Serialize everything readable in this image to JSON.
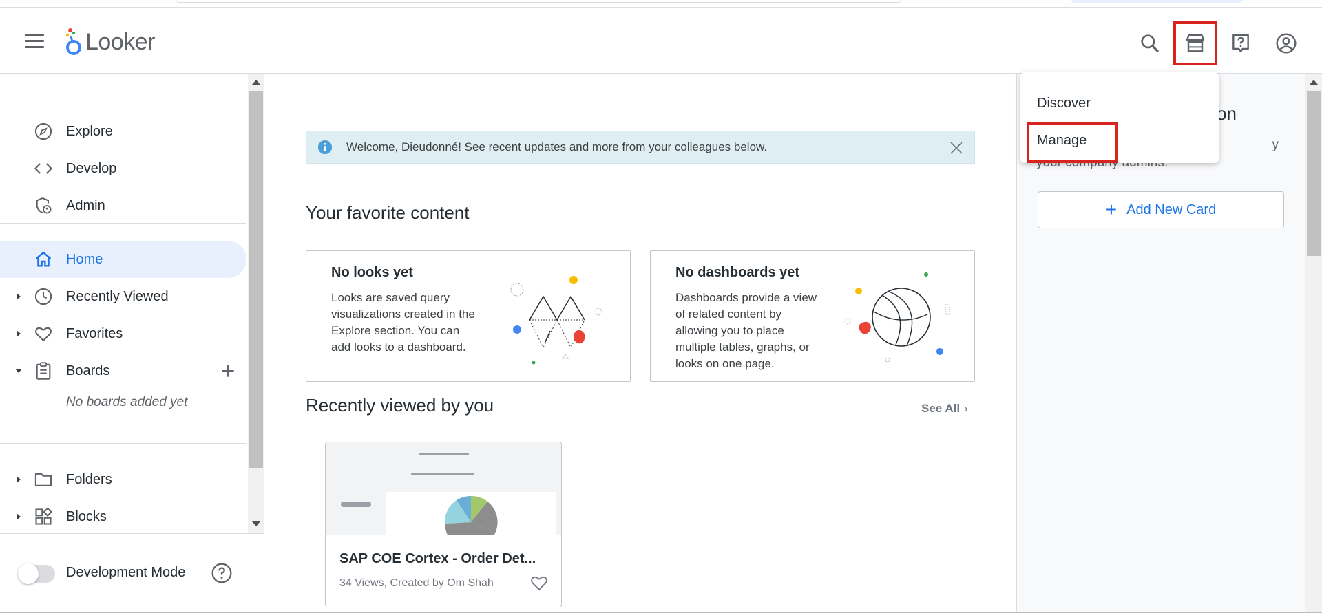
{
  "app": {
    "name": "Looker",
    "logo_icon": "looker-logo-icon"
  },
  "header": {
    "icons": [
      "menu-icon",
      "search-icon",
      "marketplace-icon",
      "help-icon",
      "account-icon"
    ]
  },
  "marketplace_menu": {
    "items": [
      {
        "label": "Discover"
      },
      {
        "label": "Manage"
      }
    ]
  },
  "sidebar": {
    "items": [
      {
        "label": "Explore",
        "icon": "compass-icon"
      },
      {
        "label": "Develop",
        "icon": "code-icon"
      },
      {
        "label": "Admin",
        "icon": "admin-shield-icon"
      },
      {
        "label": "Home",
        "icon": "home-icon"
      },
      {
        "label": "Recently Viewed",
        "icon": "clock-icon"
      },
      {
        "label": "Favorites",
        "icon": "heart-icon"
      },
      {
        "label": "Boards",
        "icon": "clipboard-icon"
      },
      {
        "label": "Folders",
        "icon": "folder-icon"
      },
      {
        "label": "Blocks",
        "icon": "blocks-icon"
      }
    ],
    "boards_empty": "No boards added yet",
    "dev_mode_label": "Development Mode"
  },
  "main": {
    "banner_text": "Welcome, Dieudonné! See recent updates and more from your colleagues below.",
    "favorites_title": "Your favorite content",
    "cards": [
      {
        "title": "No looks yet",
        "body": "Looks are saved query visualizations created in the Explore section. You can add looks to a dashboard."
      },
      {
        "title": "No dashboards yet",
        "body": "Dashboards provide a view of related content by allowing you to place multiple tables, graphs, or looks on one page."
      }
    ],
    "recent_title": "Recently viewed by you",
    "see_all": "See All",
    "recent_item": {
      "title": "SAP COE Cortex - Order Det...",
      "meta": "34 Views, Created by Om Shah"
    }
  },
  "right_panel": {
    "title_fragment": "on",
    "desc_fragment_line1": "y",
    "desc_fragment_line2": "your company admins.",
    "add_card": "Add New Card"
  },
  "colors": {
    "accent": "#1a73e8",
    "highlight": "#d9231e",
    "active_bg": "#e8f0fe",
    "banner_bg": "#dfeef2"
  }
}
